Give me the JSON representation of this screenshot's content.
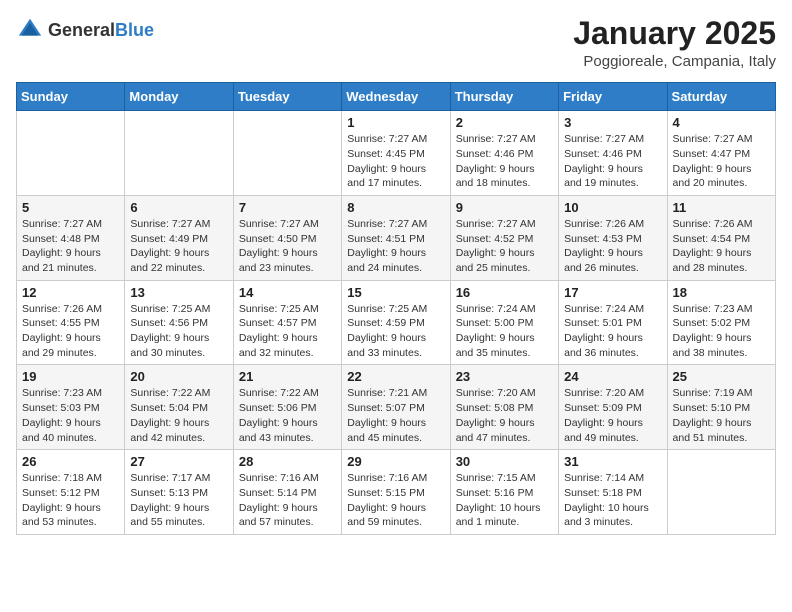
{
  "header": {
    "logo_general": "General",
    "logo_blue": "Blue",
    "month": "January 2025",
    "location": "Poggioreale, Campania, Italy"
  },
  "weekdays": [
    "Sunday",
    "Monday",
    "Tuesday",
    "Wednesday",
    "Thursday",
    "Friday",
    "Saturday"
  ],
  "weeks": [
    [
      {
        "day": "",
        "info": ""
      },
      {
        "day": "",
        "info": ""
      },
      {
        "day": "",
        "info": ""
      },
      {
        "day": "1",
        "info": "Sunrise: 7:27 AM\nSunset: 4:45 PM\nDaylight: 9 hours\nand 17 minutes."
      },
      {
        "day": "2",
        "info": "Sunrise: 7:27 AM\nSunset: 4:46 PM\nDaylight: 9 hours\nand 18 minutes."
      },
      {
        "day": "3",
        "info": "Sunrise: 7:27 AM\nSunset: 4:46 PM\nDaylight: 9 hours\nand 19 minutes."
      },
      {
        "day": "4",
        "info": "Sunrise: 7:27 AM\nSunset: 4:47 PM\nDaylight: 9 hours\nand 20 minutes."
      }
    ],
    [
      {
        "day": "5",
        "info": "Sunrise: 7:27 AM\nSunset: 4:48 PM\nDaylight: 9 hours\nand 21 minutes."
      },
      {
        "day": "6",
        "info": "Sunrise: 7:27 AM\nSunset: 4:49 PM\nDaylight: 9 hours\nand 22 minutes."
      },
      {
        "day": "7",
        "info": "Sunrise: 7:27 AM\nSunset: 4:50 PM\nDaylight: 9 hours\nand 23 minutes."
      },
      {
        "day": "8",
        "info": "Sunrise: 7:27 AM\nSunset: 4:51 PM\nDaylight: 9 hours\nand 24 minutes."
      },
      {
        "day": "9",
        "info": "Sunrise: 7:27 AM\nSunset: 4:52 PM\nDaylight: 9 hours\nand 25 minutes."
      },
      {
        "day": "10",
        "info": "Sunrise: 7:26 AM\nSunset: 4:53 PM\nDaylight: 9 hours\nand 26 minutes."
      },
      {
        "day": "11",
        "info": "Sunrise: 7:26 AM\nSunset: 4:54 PM\nDaylight: 9 hours\nand 28 minutes."
      }
    ],
    [
      {
        "day": "12",
        "info": "Sunrise: 7:26 AM\nSunset: 4:55 PM\nDaylight: 9 hours\nand 29 minutes."
      },
      {
        "day": "13",
        "info": "Sunrise: 7:25 AM\nSunset: 4:56 PM\nDaylight: 9 hours\nand 30 minutes."
      },
      {
        "day": "14",
        "info": "Sunrise: 7:25 AM\nSunset: 4:57 PM\nDaylight: 9 hours\nand 32 minutes."
      },
      {
        "day": "15",
        "info": "Sunrise: 7:25 AM\nSunset: 4:59 PM\nDaylight: 9 hours\nand 33 minutes."
      },
      {
        "day": "16",
        "info": "Sunrise: 7:24 AM\nSunset: 5:00 PM\nDaylight: 9 hours\nand 35 minutes."
      },
      {
        "day": "17",
        "info": "Sunrise: 7:24 AM\nSunset: 5:01 PM\nDaylight: 9 hours\nand 36 minutes."
      },
      {
        "day": "18",
        "info": "Sunrise: 7:23 AM\nSunset: 5:02 PM\nDaylight: 9 hours\nand 38 minutes."
      }
    ],
    [
      {
        "day": "19",
        "info": "Sunrise: 7:23 AM\nSunset: 5:03 PM\nDaylight: 9 hours\nand 40 minutes."
      },
      {
        "day": "20",
        "info": "Sunrise: 7:22 AM\nSunset: 5:04 PM\nDaylight: 9 hours\nand 42 minutes."
      },
      {
        "day": "21",
        "info": "Sunrise: 7:22 AM\nSunset: 5:06 PM\nDaylight: 9 hours\nand 43 minutes."
      },
      {
        "day": "22",
        "info": "Sunrise: 7:21 AM\nSunset: 5:07 PM\nDaylight: 9 hours\nand 45 minutes."
      },
      {
        "day": "23",
        "info": "Sunrise: 7:20 AM\nSunset: 5:08 PM\nDaylight: 9 hours\nand 47 minutes."
      },
      {
        "day": "24",
        "info": "Sunrise: 7:20 AM\nSunset: 5:09 PM\nDaylight: 9 hours\nand 49 minutes."
      },
      {
        "day": "25",
        "info": "Sunrise: 7:19 AM\nSunset: 5:10 PM\nDaylight: 9 hours\nand 51 minutes."
      }
    ],
    [
      {
        "day": "26",
        "info": "Sunrise: 7:18 AM\nSunset: 5:12 PM\nDaylight: 9 hours\nand 53 minutes."
      },
      {
        "day": "27",
        "info": "Sunrise: 7:17 AM\nSunset: 5:13 PM\nDaylight: 9 hours\nand 55 minutes."
      },
      {
        "day": "28",
        "info": "Sunrise: 7:16 AM\nSunset: 5:14 PM\nDaylight: 9 hours\nand 57 minutes."
      },
      {
        "day": "29",
        "info": "Sunrise: 7:16 AM\nSunset: 5:15 PM\nDaylight: 9 hours\nand 59 minutes."
      },
      {
        "day": "30",
        "info": "Sunrise: 7:15 AM\nSunset: 5:16 PM\nDaylight: 10 hours\nand 1 minute."
      },
      {
        "day": "31",
        "info": "Sunrise: 7:14 AM\nSunset: 5:18 PM\nDaylight: 10 hours\nand 3 minutes."
      },
      {
        "day": "",
        "info": ""
      }
    ]
  ]
}
